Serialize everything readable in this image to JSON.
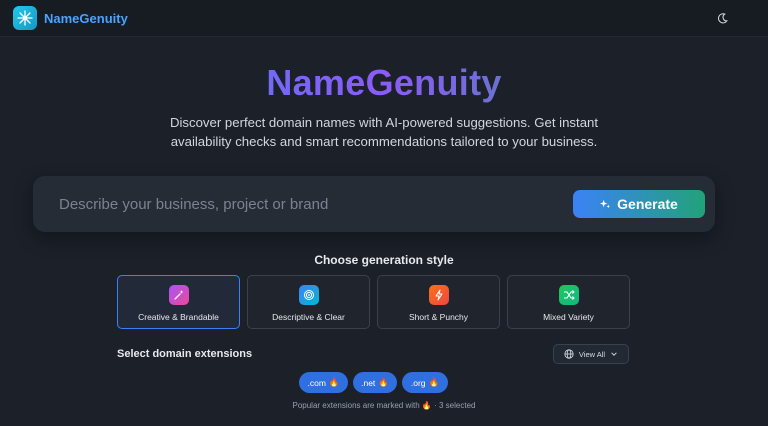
{
  "header": {
    "brand": "NameGenuity",
    "logo_icon": "sparkle-network-icon",
    "theme_icon": "moon-icon"
  },
  "hero": {
    "title": "NameGenuity",
    "subtitle": "Discover perfect domain names with AI-powered suggestions. Get instant availability checks and smart recommendations tailored to your business."
  },
  "search": {
    "placeholder": "Describe your business, project or brand",
    "value": "",
    "generate_label": "Generate",
    "generate_icon": "sparkles-icon"
  },
  "styles": {
    "title": "Choose generation style",
    "options": [
      {
        "label": "Creative & Brandable",
        "icon": "magic-wand-icon",
        "color": "#a855f7",
        "selected": true
      },
      {
        "label": "Descriptive & Clear",
        "icon": "target-icon",
        "color": "#3b82f6",
        "selected": false
      },
      {
        "label": "Short & Punchy",
        "icon": "lightning-icon",
        "color": "#ef4444",
        "selected": false
      },
      {
        "label": "Mixed Variety",
        "icon": "shuffle-icon",
        "color": "#22c55e",
        "selected": false
      }
    ]
  },
  "extensions": {
    "title": "Select domain extensions",
    "view_all_label": "View All",
    "items": [
      {
        "label": ".com",
        "popular": true
      },
      {
        "label": ".net",
        "popular": true
      },
      {
        "label": ".org",
        "popular": true
      }
    ],
    "note_prefix": "Popular extensions are marked with",
    "note_suffix": "· 3 selected"
  }
}
